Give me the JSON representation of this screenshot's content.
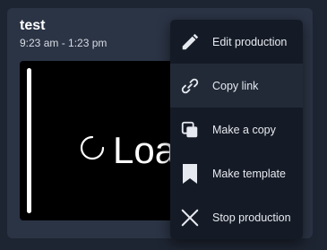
{
  "card": {
    "title": "test",
    "time_range": "9:23 am - 1:23 pm",
    "preview": {
      "loading_text": "Loa",
      "spinner_icon": "loading-spinner-icon"
    }
  },
  "menu": {
    "items": [
      {
        "label": "Edit production",
        "icon": "pencil-icon"
      },
      {
        "label": "Copy link",
        "icon": "link-icon",
        "hovered": true
      },
      {
        "label": "Make a copy",
        "icon": "copy-icon"
      },
      {
        "label": "Make template",
        "icon": "bookmark-icon"
      },
      {
        "label": "Stop production",
        "icon": "close-icon"
      }
    ]
  },
  "colors": {
    "background": "#1e2532",
    "card": "#2b3445",
    "menu": "#151b26",
    "menu_hover": "#222a38",
    "text": "#ffffff"
  }
}
